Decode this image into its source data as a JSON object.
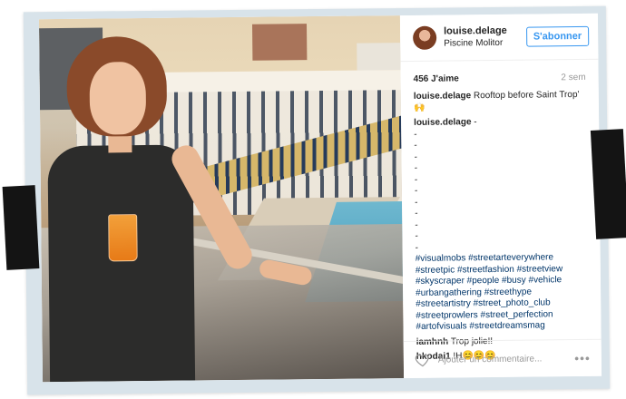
{
  "post": {
    "username": "louise.delage",
    "location": "Piscine Molitor",
    "follow_label": "S'abonner",
    "likes": "456 J'aime",
    "time_ago": "2 sem",
    "caption_user": "louise.delage",
    "caption_text": " Rooftop before Saint Trop' 🙌",
    "comments": [
      {
        "user": "louise.delage",
        "text": " -",
        "dashes": [
          "-",
          "-",
          "-",
          "-",
          "-",
          "-",
          "-",
          "-",
          "-",
          "-",
          "-"
        ],
        "hashtags": "#visualmobs #streetarteverywhere #streetpic #streetfashion #streetview #skyscraper #people #busy #vehicle #urbangathering #streethype #streetartistry #street_photo_club #streetprowlers #street_perfection #artofvisuals #streetdreamsmag"
      },
      {
        "user": "iamhnh",
        "text": " Trop jolie!!"
      },
      {
        "user": "hkodai1",
        "text": " !H😊😊😊"
      }
    ],
    "add_comment_placeholder": "Ajouter un commentaire...",
    "more_label": "•••"
  },
  "icons": {
    "like": "heart-outline",
    "more": "ellipsis"
  },
  "colors": {
    "frame_bg": "#d8e3ea",
    "follow_blue": "#3897f0",
    "hashtag": "#003569",
    "tape": "#141414"
  }
}
